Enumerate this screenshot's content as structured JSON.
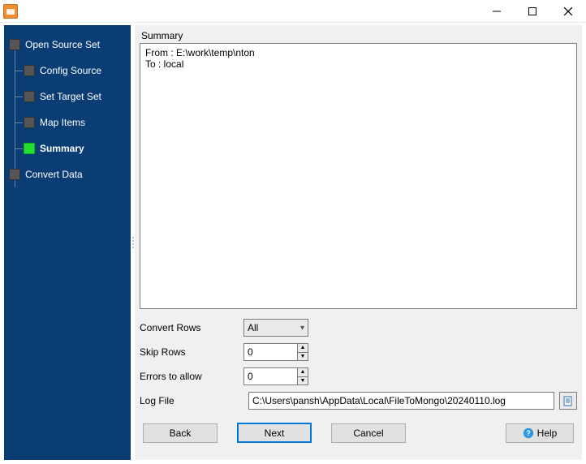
{
  "sidebar": {
    "items": [
      {
        "label": "Open Source Set"
      },
      {
        "label": "Config Source"
      },
      {
        "label": "Set Target Set"
      },
      {
        "label": "Map Items"
      },
      {
        "label": "Summary"
      },
      {
        "label": "Convert Data"
      }
    ]
  },
  "summary": {
    "section_label": "Summary",
    "text": "From : E:\\work\\temp\\nton\nTo : local"
  },
  "form": {
    "convert_rows_label": "Convert Rows",
    "convert_rows_value": "All",
    "skip_rows_label": "Skip Rows",
    "skip_rows_value": "0",
    "errors_allow_label": "Errors to allow",
    "errors_allow_value": "0",
    "log_file_label": "Log File",
    "log_file_value": "C:\\Users\\pansh\\AppData\\Local\\FileToMongo\\20240110.log"
  },
  "buttons": {
    "back": "Back",
    "next": "Next",
    "cancel": "Cancel",
    "help": "Help"
  }
}
